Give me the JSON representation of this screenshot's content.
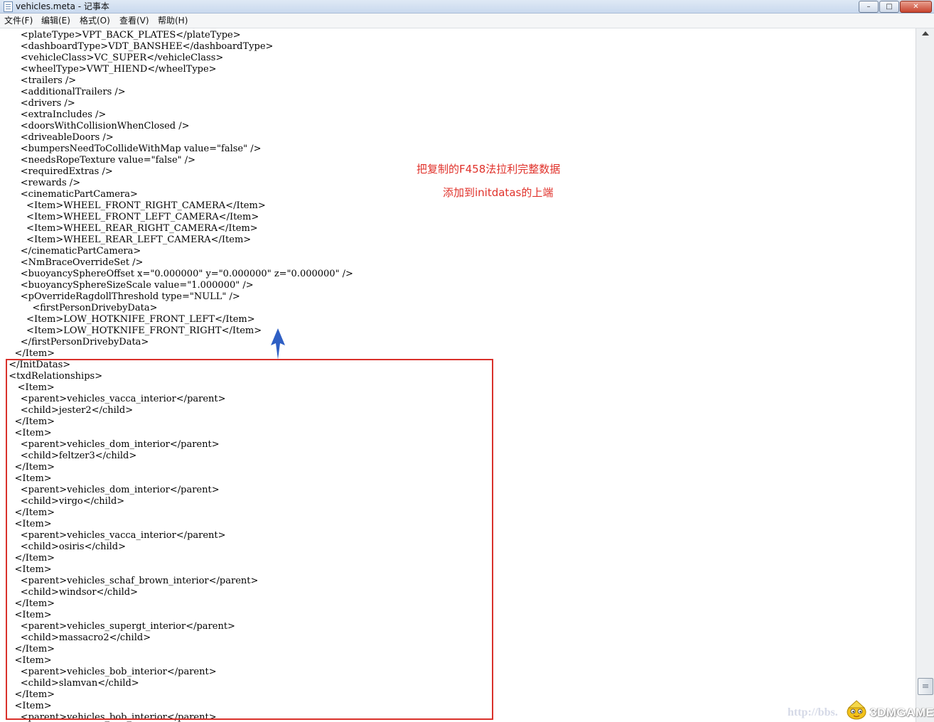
{
  "window": {
    "title": "vehicles.meta - 记事本"
  },
  "menu": [
    "文件(F)",
    "编辑(E)",
    "格式(O)",
    "查看(V)",
    "帮助(H)"
  ],
  "editor_lines": [
    "      <plateType>VPT_BACK_PLATES</plateType>",
    "      <dashboardType>VDT_BANSHEE</dashboardType>",
    "      <vehicleClass>VC_SUPER</vehicleClass>",
    "      <wheelType>VWT_HIEND</wheelType>",
    "      <trailers />",
    "      <additionalTrailers />",
    "      <drivers />",
    "      <extraIncludes />",
    "      <doorsWithCollisionWhenClosed />",
    "      <driveableDoors />",
    "      <bumpersNeedToCollideWithMap value=\"false\" />",
    "      <needsRopeTexture value=\"false\" />",
    "      <requiredExtras />",
    "      <rewards />",
    "      <cinematicPartCamera>",
    "        <Item>WHEEL_FRONT_RIGHT_CAMERA</Item>",
    "        <Item>WHEEL_FRONT_LEFT_CAMERA</Item>",
    "        <Item>WHEEL_REAR_RIGHT_CAMERA</Item>",
    "        <Item>WHEEL_REAR_LEFT_CAMERA</Item>",
    "      </cinematicPartCamera>",
    "      <NmBraceOverrideSet />",
    "      <buoyancySphereOffset x=\"0.000000\" y=\"0.000000\" z=\"0.000000\" />",
    "      <buoyancySphereSizeScale value=\"1.000000\" />",
    "      <pOverrideRagdollThreshold type=\"NULL\" />",
    "          <firstPersonDrivebyData>",
    "        <Item>LOW_HOTKNIFE_FRONT_LEFT</Item>",
    "        <Item>LOW_HOTKNIFE_FRONT_RIGHT</Item>",
    "      </firstPersonDrivebyData>",
    "    </Item>",
    "  </InitDatas>",
    "  <txdRelationships>",
    "     <Item>",
    "      <parent>vehicles_vacca_interior</parent>",
    "      <child>jester2</child>",
    "    </Item>",
    "    <Item>",
    "      <parent>vehicles_dom_interior</parent>",
    "      <child>feltzer3</child>",
    "    </Item>",
    "    <Item>",
    "      <parent>vehicles_dom_interior</parent>",
    "      <child>virgo</child>",
    "    </Item>",
    "    <Item>",
    "      <parent>vehicles_vacca_interior</parent>",
    "      <child>osiris</child>",
    "    </Item>",
    "    <Item>",
    "      <parent>vehicles_schaf_brown_interior</parent>",
    "      <child>windsor</child>",
    "    </Item>",
    "    <Item>",
    "      <parent>vehicles_supergt_interior</parent>",
    "      <child>massacro2</child>",
    "    </Item>",
    "    <Item>",
    "      <parent>vehicles_bob_interior</parent>",
    "      <child>slamvan</child>",
    "    </Item>",
    "    <Item>",
    "      <parent>vehicles_bob_interior</parent>"
  ],
  "annotation": {
    "line1": "把复制的F458法拉利完整数据",
    "line2": "添加到initdatas的上端",
    "color": "#e0312a"
  },
  "highlight": {
    "border_color": "#d9312b",
    "arrow_color": "#2f5fc4"
  },
  "watermark": {
    "url": "http://bbs.",
    "brand": "3DMGAME"
  }
}
